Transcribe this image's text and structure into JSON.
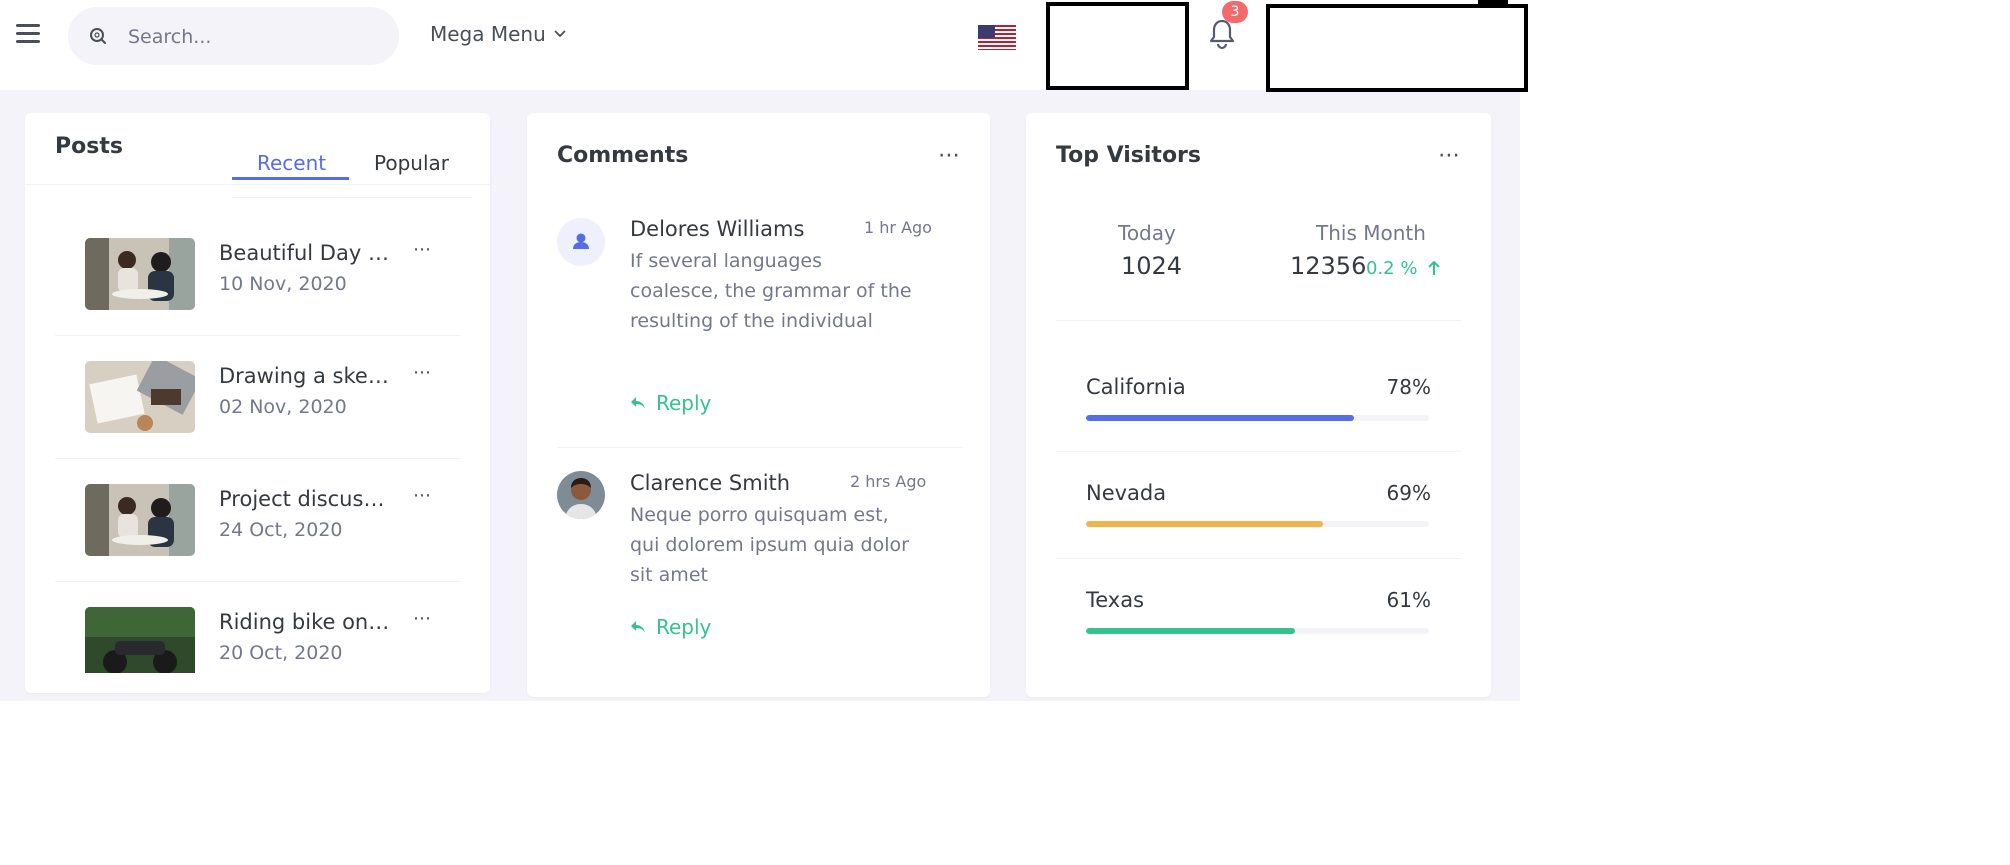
{
  "topbar": {
    "search_placeholder": "Search...",
    "mega_menu_label": "Mega Menu",
    "notification_count": "3"
  },
  "posts": {
    "title": "Posts",
    "tabs": [
      {
        "label": "Recent",
        "active": true
      },
      {
        "label": "Popular",
        "active": false
      }
    ],
    "items": [
      {
        "title": "Beautiful Day with Friends",
        "date": "10 Nov, 2020",
        "image": "meeting-photo"
      },
      {
        "title": "Drawing a sketch",
        "date": "02 Nov, 2020",
        "image": "laptop-desk-photo"
      },
      {
        "title": "Project discussion with team",
        "date": "24 Oct, 2020",
        "image": "meeting-photo"
      },
      {
        "title": "Riding bike on road",
        "date": "20 Oct, 2020",
        "image": "motorbike-photo"
      }
    ]
  },
  "comments": {
    "title": "Comments",
    "items": [
      {
        "name": "Delores Williams",
        "time": "1 hr Ago",
        "text": "If several languages coalesce, the grammar of the resulting of the individual",
        "reply_label": "Reply",
        "avatar": "user-icon"
      },
      {
        "name": "Clarence Smith",
        "time": "2 hrs Ago",
        "text": "Neque porro quisquam est, qui dolorem ipsum quia dolor sit amet",
        "reply_label": "Reply",
        "avatar": "person-photo"
      }
    ]
  },
  "visitors": {
    "title": "Top Visitors",
    "today_label": "Today",
    "today_value": "1024",
    "month_label": "This Month",
    "month_value": "12356",
    "month_trend": "0.2 %",
    "states": [
      {
        "name": "California",
        "percent": "78%",
        "value": 78,
        "color": "#556ee6"
      },
      {
        "name": "Nevada",
        "percent": "69%",
        "value": 69,
        "color": "#f1b44c"
      },
      {
        "name": "Texas",
        "percent": "61%",
        "value": 61,
        "color": "#34c38f"
      }
    ]
  }
}
